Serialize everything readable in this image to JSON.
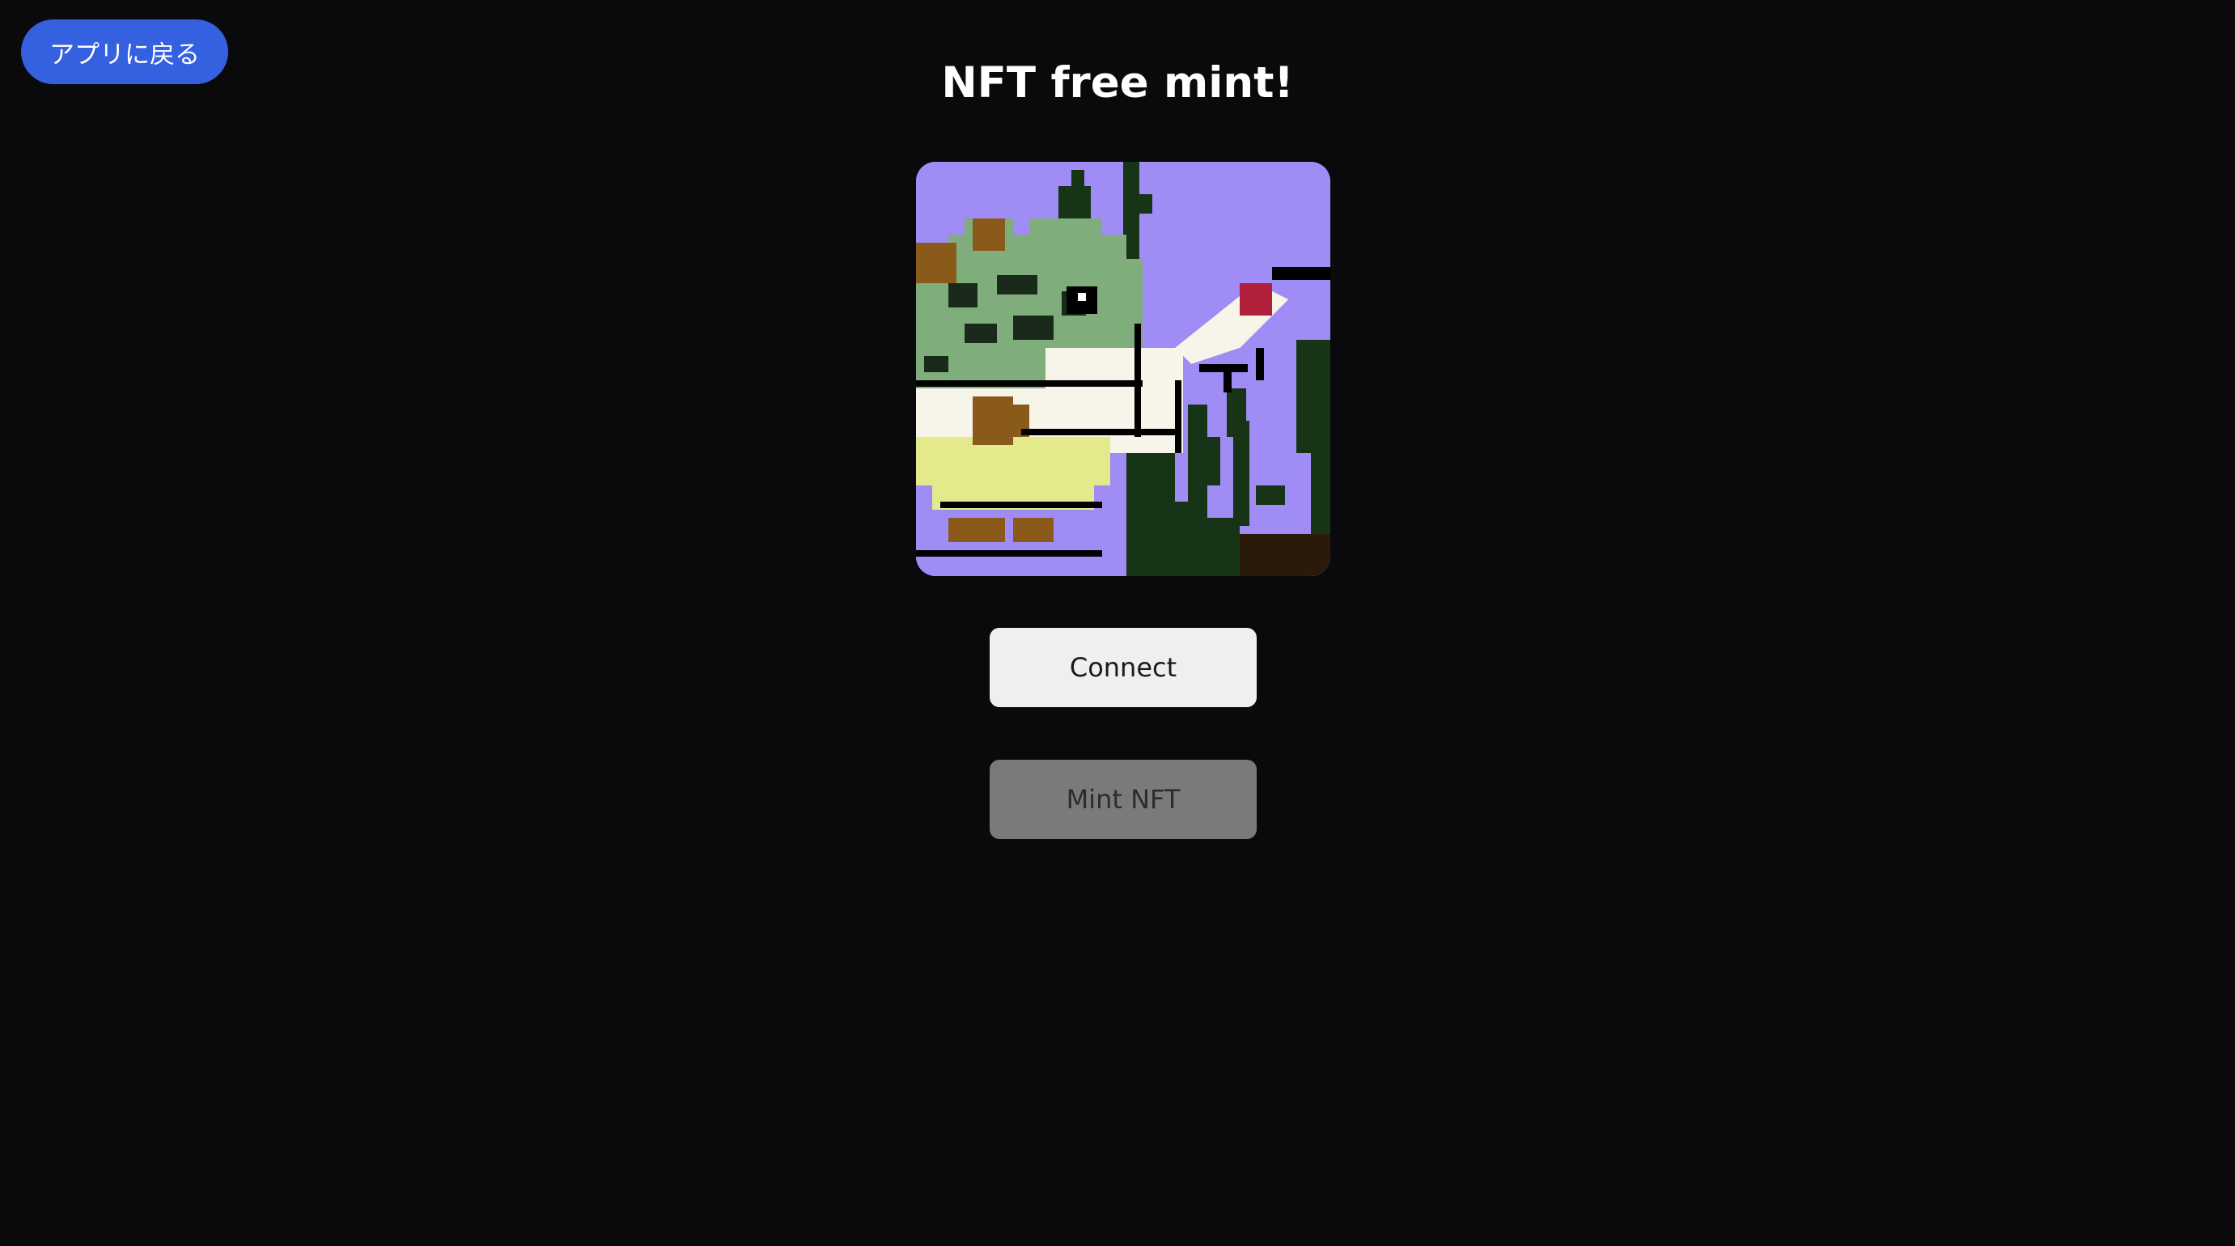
{
  "back_button": {
    "label": "アプリに戻る"
  },
  "header": {
    "title": "NFT free mint!"
  },
  "nft_image": {
    "name": "pixel-art-nft-image"
  },
  "actions": {
    "connect_label": "Connect",
    "mint_label": "Mint NFT",
    "mint_disabled": true
  },
  "colors": {
    "background": "#0a0a0c",
    "back_button": "#3560e0",
    "connect_button": "#efeff1",
    "mint_button_disabled": "#7a7a7a",
    "nft_sky": "#a08cf5",
    "nft_frog": "#7fae7c",
    "nft_belly": "#f7f5ea",
    "nft_yellow": "#e4ea8c",
    "nft_brown": "#8a5a1a",
    "nft_weed": "#1a3a1a",
    "nft_red": "#b0203a"
  }
}
